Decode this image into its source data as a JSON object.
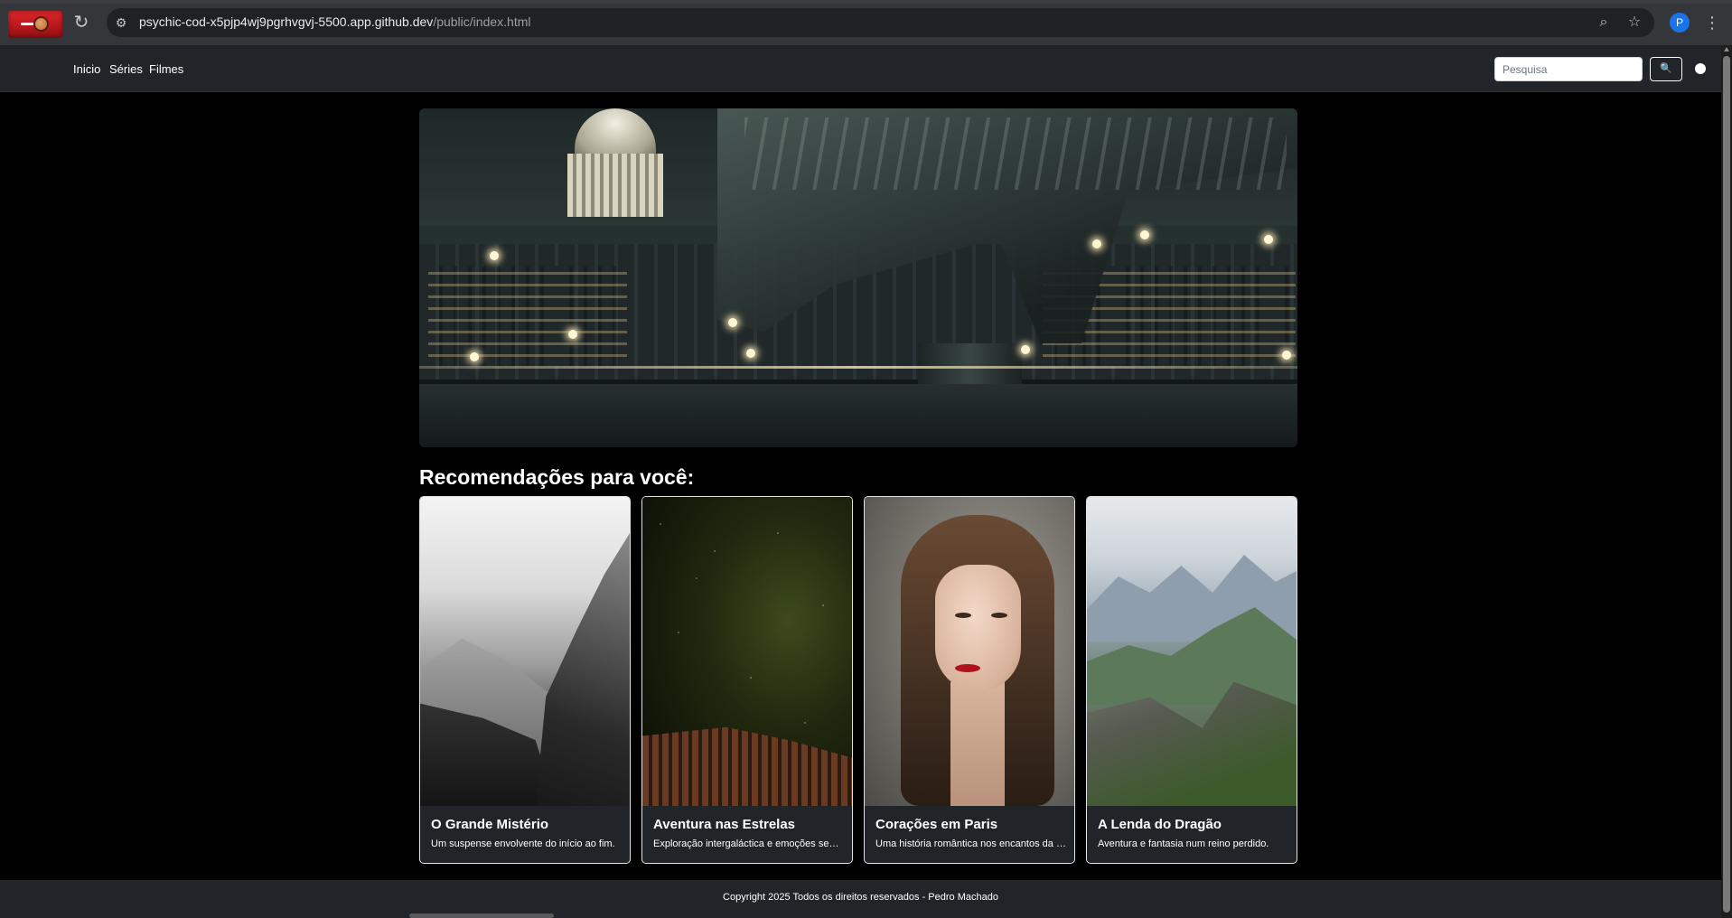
{
  "browser": {
    "url_host": "psychic-cod-x5pjp4wj9pgrhvgvj-5500.app.github.dev",
    "url_path": "/public/index.html",
    "profile_initial": "P",
    "icons": [
      "back-icon",
      "forward-icon",
      "reload-icon",
      "site-info-icon",
      "zoom-icon",
      "bookmark-star-icon",
      "menu-dots-icon"
    ]
  },
  "navbar": {
    "links": [
      "Inicio",
      "Séries",
      "Filmes"
    ],
    "search_placeholder": "Pesquisa",
    "search_button_icon": "search-icon",
    "brand_color": "#dc2626"
  },
  "section": {
    "title": "Recomendações para você:"
  },
  "cards": [
    {
      "title": "O Grande Mistério",
      "text": "Um suspense envolvente do início ao fim."
    },
    {
      "title": "Aventura nas Estrelas",
      "text": "Exploração intergaláctica e emoções sem fim."
    },
    {
      "title": "Corações em Paris",
      "text": "Uma história romântica nos encantos da França."
    },
    {
      "title": "A Lenda do Dragão",
      "text": "Aventura e fantasia num reino perdido."
    }
  ],
  "footer": {
    "text": "Copyright 2025 Todos os direitos reservados - Pedro Machado"
  }
}
